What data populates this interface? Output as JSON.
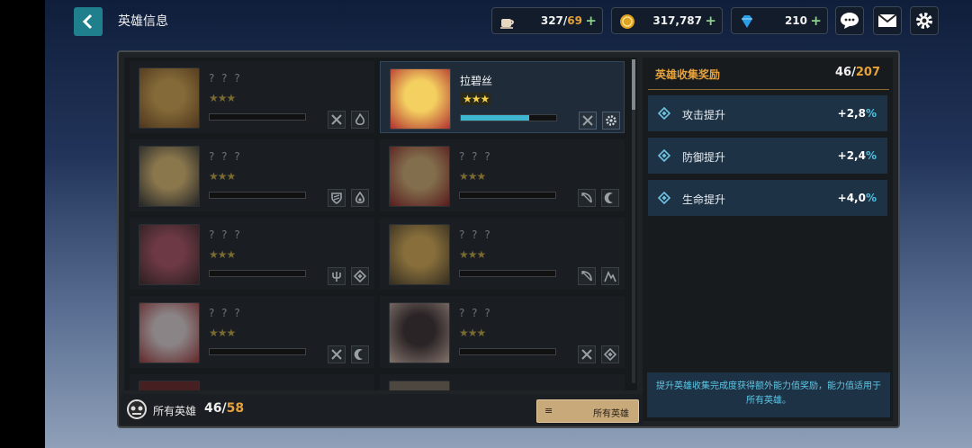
{
  "header": {
    "title": "英雄信息",
    "resources": [
      {
        "icon": "coffee-icon",
        "value": "327",
        "max": "69"
      },
      {
        "icon": "gold-coin-icon",
        "value": "317,787",
        "max": ""
      },
      {
        "icon": "diamond-gem-icon",
        "value": "210",
        "max": ""
      }
    ],
    "plus": "+"
  },
  "heroes": [
    {
      "name": "? ? ?",
      "stars": "★★★",
      "progress": 0,
      "selected": false,
      "icons": [
        "crossed-swords-icon",
        "flame-icon"
      ],
      "palette": [
        "#d9a84a",
        "#7a4a1a"
      ]
    },
    {
      "name": "拉碧丝",
      "stars": "★★★",
      "progress": 0.72,
      "selected": true,
      "icons": [
        "crossed-swords-icon",
        "gear-icon"
      ],
      "palette": [
        "#f4d060",
        "#b03030"
      ]
    },
    {
      "name": "? ? ?",
      "stars": "★★★",
      "progress": 0,
      "selected": false,
      "icons": [
        "shield-icon",
        "water-drop-icon"
      ],
      "palette": [
        "#e6c070",
        "#2a2a2a"
      ]
    },
    {
      "name": "? ? ?",
      "stars": "★★★",
      "progress": 0,
      "selected": false,
      "icons": [
        "bow-icon",
        "moon-icon"
      ],
      "palette": [
        "#d8b070",
        "#8a1a1a"
      ]
    },
    {
      "name": "? ? ?",
      "stars": "★★★",
      "progress": 0,
      "selected": false,
      "icons": [
        "trident-icon",
        "rune-diamond-icon"
      ],
      "palette": [
        "#b05060",
        "#3a2020"
      ]
    },
    {
      "name": "? ? ?",
      "stars": "★★★",
      "progress": 0,
      "selected": false,
      "icons": [
        "bow-icon",
        "mountain-icon"
      ],
      "palette": [
        "#e0b050",
        "#4a3a20"
      ]
    },
    {
      "name": "? ? ?",
      "stars": "★★★",
      "progress": 0,
      "selected": false,
      "icons": [
        "crossed-swords-icon",
        "moon-icon"
      ],
      "palette": [
        "#e8d8d8",
        "#a03030"
      ]
    },
    {
      "name": "? ? ?",
      "stars": "★★★",
      "progress": 0,
      "selected": false,
      "icons": [
        "crossed-swords-icon",
        "rune-diamond-icon"
      ],
      "palette": [
        "#3a2a2a",
        "#d8b8a8"
      ]
    }
  ],
  "footer": {
    "label": "所有英雄",
    "count": "46",
    "max": "58",
    "filter_label": "所有英雄",
    "menu_glyph": "≡"
  },
  "rewards": {
    "title": "英雄收集奖励",
    "count": "46",
    "max": "207",
    "stats": [
      {
        "label": "攻击提升",
        "value": "+2,8",
        "pct": "%"
      },
      {
        "label": "防御提升",
        "value": "+2,4",
        "pct": "%"
      },
      {
        "label": "生命提升",
        "value": "+4,0",
        "pct": "%"
      }
    ],
    "note": "提升英雄收集完成度获得额外能力值奖励，能力值适用于所有英雄。"
  },
  "colors": {
    "accent": "#e6a23c",
    "cyan": "#3fb6d0",
    "back": "#1f7f8c"
  }
}
